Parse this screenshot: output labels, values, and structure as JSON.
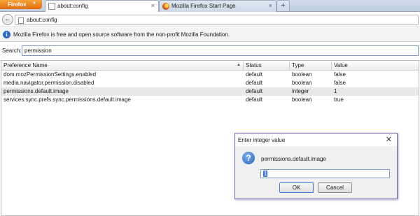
{
  "browser": {
    "menu_button": "Firefox",
    "tabs": [
      {
        "title": "about:config",
        "active": true,
        "icon": "blank-page-icon"
      },
      {
        "title": "Mozilla Firefox Start Page",
        "active": false,
        "icon": "firefox-icon"
      }
    ],
    "tab_close": "×",
    "new_tab": "+",
    "back": "←",
    "url": "about:config"
  },
  "infobar": {
    "icon": "i",
    "text": "Mozilla Firefox is free and open source software from the non-profit Mozilla Foundation."
  },
  "search": {
    "label": "Search:",
    "value": "permission"
  },
  "table": {
    "columns": [
      "Preference Name",
      "Status",
      "Type",
      "Value"
    ],
    "sort_indicator": "▲",
    "rows": [
      {
        "name": "dom.mozPermissionSettings.enabled",
        "status": "default",
        "type": "boolean",
        "value": "false"
      },
      {
        "name": "media.navigator.permission.disabled",
        "status": "default",
        "type": "boolean",
        "value": "false"
      },
      {
        "name": "permissions.default.image",
        "status": "default",
        "type": "integer",
        "value": "1"
      },
      {
        "name": "services.sync.prefs.sync.permissions.default.image",
        "status": "default",
        "type": "boolean",
        "value": "true"
      }
    ]
  },
  "dialog": {
    "title": "Enter integer value",
    "close": "✕",
    "icon": "?",
    "message": "permissions.default.image",
    "input_value": "1",
    "ok_label": "OK",
    "cancel_label": "Cancel"
  },
  "colors": {
    "firefox_button": "#e46c0a",
    "info_icon": "#2e6cc8",
    "selected_row": "#e8e8e8",
    "dialog_border": "#6a6abf"
  }
}
